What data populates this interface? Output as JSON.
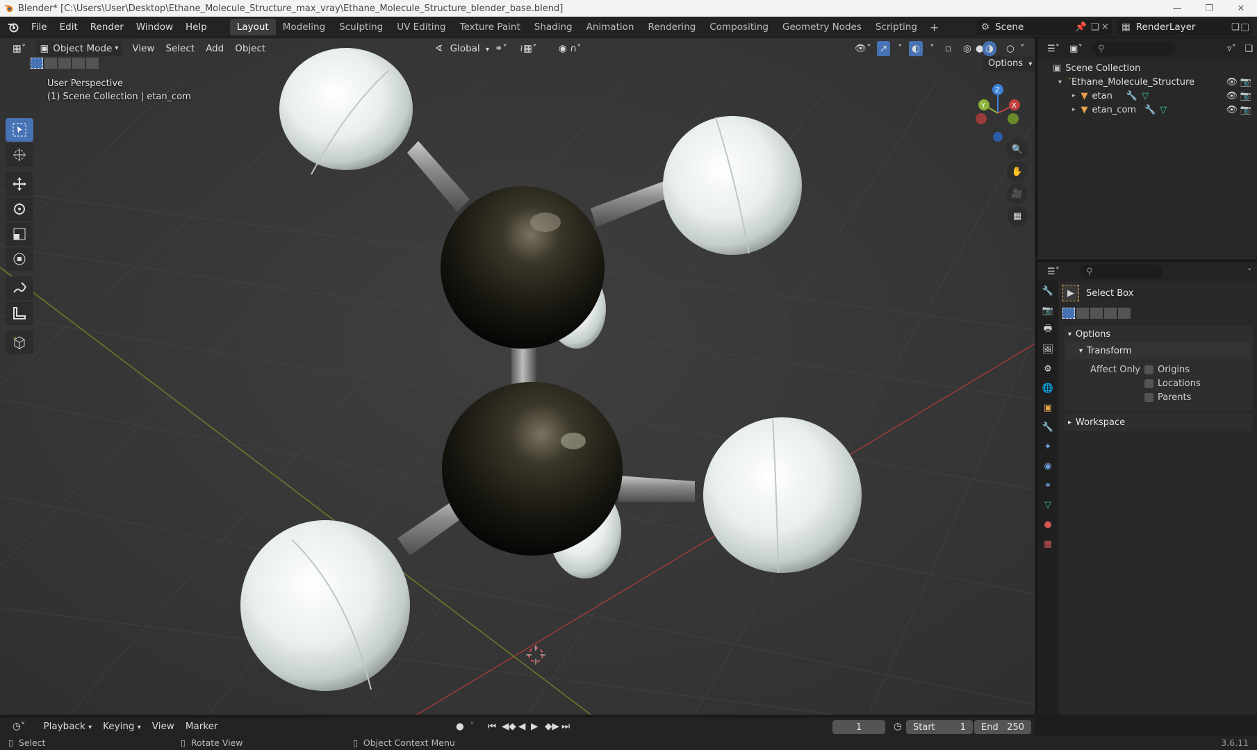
{
  "window": {
    "title": "Blender* [C:\\Users\\User\\Desktop\\Ethane_Molecule_Structure_max_vray\\Ethane_Molecule_Structure_blender_base.blend]"
  },
  "menu": {
    "file": "File",
    "edit": "Edit",
    "render": "Render",
    "window": "Window",
    "help": "Help"
  },
  "workspaces": [
    "Layout",
    "Modeling",
    "Sculpting",
    "UV Editing",
    "Texture Paint",
    "Shading",
    "Animation",
    "Rendering",
    "Compositing",
    "Geometry Nodes",
    "Scripting"
  ],
  "active_workspace": "Layout",
  "scene": {
    "name": "Scene",
    "render_layer": "RenderLayer"
  },
  "viewport": {
    "mode": "Object Mode",
    "menus": {
      "view": "View",
      "select": "Select",
      "add": "Add",
      "object": "Object"
    },
    "orientation": "Global",
    "options": "Options",
    "overlay_line1": "User Perspective",
    "overlay_line2": "(1) Scene Collection | etan_com",
    "gizmo": {
      "x": "X",
      "y": "Y",
      "z": "Z"
    }
  },
  "outliner": {
    "root": "Scene Collection",
    "items": [
      {
        "label": "Ethane_Molecule_Structure"
      },
      {
        "label": "etan"
      },
      {
        "label": "etan_com"
      }
    ]
  },
  "properties": {
    "tool_name": "Select Box",
    "options": "Options",
    "transform": "Transform",
    "affect_only": "Affect Only",
    "checkboxes": [
      "Origins",
      "Locations",
      "Parents"
    ],
    "workspace": "Workspace"
  },
  "timeline": {
    "playback": "Playback",
    "keying": "Keying",
    "view": "View",
    "marker": "Marker",
    "current_frame": "1",
    "start_label": "Start",
    "start": "1",
    "end_label": "End",
    "end": "250"
  },
  "status": {
    "select": "Select",
    "rotate": "Rotate View",
    "context": "Object Context Menu",
    "version": "3.6.11"
  },
  "colors": {
    "accent": "#4772b3",
    "viewport_bg": "#393939",
    "x_axis": "#c2413f",
    "y_axis": "#8eb33a",
    "z_axis": "#3c82d6"
  }
}
